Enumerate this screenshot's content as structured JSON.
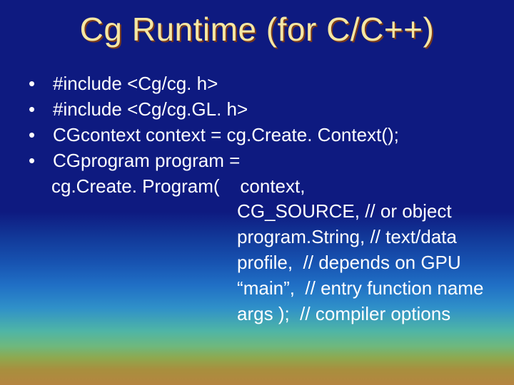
{
  "title": "Cg Runtime (for C/C++)",
  "lines": {
    "l1": "#include <Cg/cg. h>",
    "l2": "#include <Cg/cg.GL. h>",
    "l3": "CGcontext context = cg.Create. Context();",
    "l4": "CGprogram program =",
    "c1": "cg.Create. Program(    context,",
    "c2": "                                    CG_SOURCE, // or object",
    "c3": "                                    program.String, // text/data",
    "c4": "                                    profile,  // depends on GPU",
    "c5": "                                    “main”,  // entry function name",
    "c6": "                                    args );  // compiler options"
  }
}
